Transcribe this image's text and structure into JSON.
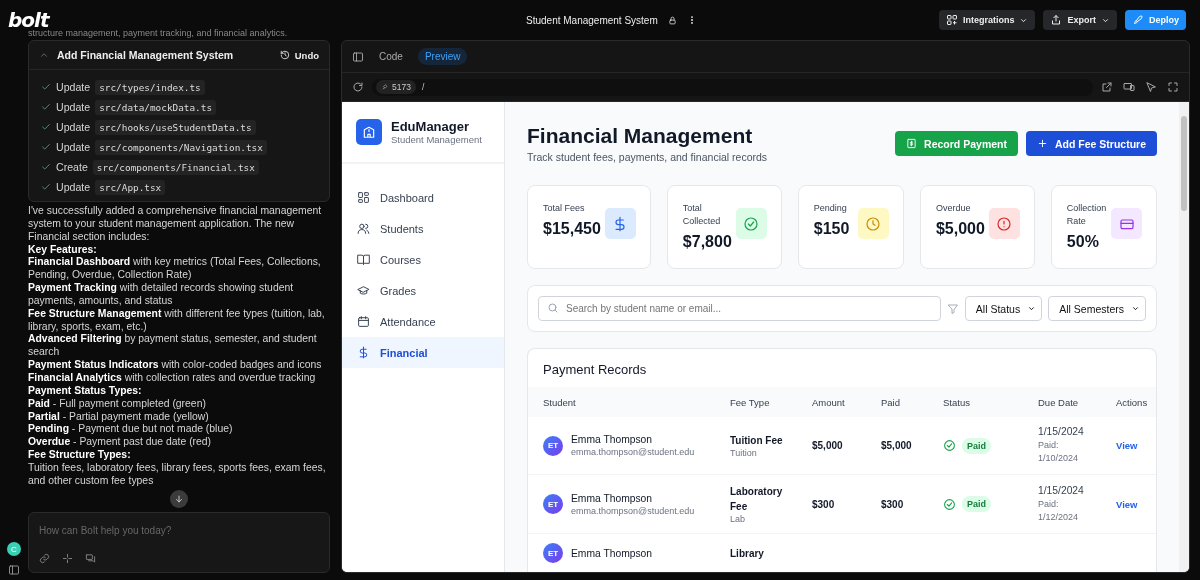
{
  "header": {
    "logo": "bolt",
    "project_title": "Student Management System",
    "buttons": [
      {
        "label": "Integrations",
        "kind": "integrations"
      },
      {
        "label": "Export",
        "kind": "export"
      },
      {
        "label": "Deploy",
        "kind": "deploy"
      }
    ]
  },
  "chat": {
    "cut_line": "structure management, payment tracking, and financial analytics.",
    "action_card": {
      "title": "Add Financial Management System",
      "undo": "Undo",
      "expanded": true,
      "steps": [
        {
          "verb": "Update",
          "file": "src/types/index.ts",
          "done": true
        },
        {
          "verb": "Update",
          "file": "src/data/mockData.ts",
          "done": true
        },
        {
          "verb": "Update",
          "file": "src/hooks/useStudentData.ts",
          "done": true
        },
        {
          "verb": "Update",
          "file": "src/components/Navigation.tsx",
          "done": true
        },
        {
          "verb": "Create",
          "file": "src/components/Financial.tsx",
          "done": true
        },
        {
          "verb": "Update",
          "file": "src/App.tsx",
          "done": true
        }
      ]
    },
    "message": [
      {
        "kind": "text",
        "text": "I've successfully added a comprehensive financial management system to your student management application. The new Financial section includes:"
      },
      {
        "kind": "heading",
        "text": "Key Features:"
      },
      {
        "kind": "text",
        "text": "**Financial Dashboard** with key metrics (Total Fees, Collections, Pending, Overdue, Collection Rate)"
      },
      {
        "kind": "text",
        "text": "**Payment Tracking** with detailed records showing student payments, amounts, and status"
      },
      {
        "kind": "text",
        "text": "**Fee Structure Management** with different fee types (tuition, lab, library, sports, exam, etc.)"
      },
      {
        "kind": "text",
        "text": "**Advanced Filtering** by payment status, semester, and student search"
      },
      {
        "kind": "text",
        "text": "**Payment Status Indicators** with color-coded badges and icons"
      },
      {
        "kind": "text",
        "text": "**Financial Analytics** with collection rates and overdue tracking"
      },
      {
        "kind": "heading",
        "text": "Payment Status Types:"
      },
      {
        "kind": "text",
        "text": "**Paid** - Full payment completed (green)"
      },
      {
        "kind": "text",
        "text": "**Partial** - Partial payment made (yellow)"
      },
      {
        "kind": "text",
        "text": "**Pending** - Payment due but not made (blue)"
      },
      {
        "kind": "text",
        "text": "**Overdue** - Payment past due date (red)"
      },
      {
        "kind": "heading",
        "text": "Fee Structure Types:"
      },
      {
        "kind": "text",
        "text": "Tuition fees, laboratory fees, library fees, sports fees, exam fees, and other custom fee types"
      }
    ],
    "input": {
      "placeholder": "How can Bolt help you today?"
    },
    "user_initial": "C"
  },
  "preview": {
    "tabs": [
      {
        "label": "Code",
        "selected": false
      },
      {
        "label": "Preview",
        "selected": true
      }
    ],
    "port": "5173",
    "path": "/"
  },
  "app": {
    "brand": {
      "name": "EduManager",
      "subtitle": "Student Management"
    },
    "nav": [
      {
        "label": "Dashboard",
        "kind": "grid",
        "selected": false
      },
      {
        "label": "Students",
        "kind": "users",
        "selected": false
      },
      {
        "label": "Courses",
        "kind": "book",
        "selected": false
      },
      {
        "label": "Grades",
        "kind": "cap",
        "selected": false
      },
      {
        "label": "Attendance",
        "kind": "calendar",
        "selected": false
      },
      {
        "label": "Financial",
        "kind": "dollar",
        "selected": true
      }
    ],
    "title": "Financial Management",
    "subtitle": "Track student fees, payments, and financial records",
    "actions": [
      {
        "label": "Record Payment",
        "kind": "record"
      },
      {
        "label": "Add Fee Structure",
        "kind": "add"
      }
    ],
    "stats": [
      {
        "label": "Total Fees",
        "value": "$15,450",
        "kind": "dollar"
      },
      {
        "label": "Total Collected",
        "value": "$7,800",
        "kind": "check"
      },
      {
        "label": "Pending",
        "value": "$150",
        "kind": "clock"
      },
      {
        "label": "Overdue",
        "value": "$5,000",
        "kind": "alert"
      },
      {
        "label": "Collection Rate",
        "value": "50%",
        "kind": "card"
      }
    ],
    "search": {
      "placeholder": "Search by student name or email..."
    },
    "filters": [
      "All Status",
      "All Semesters"
    ],
    "table": {
      "title": "Payment Records",
      "columns": [
        "Student",
        "Fee Type",
        "Amount",
        "Paid",
        "Status",
        "Due Date",
        "Actions"
      ],
      "rows": [
        {
          "initials": "ET",
          "name": "Emma Thompson",
          "email": "emma.thompson@student.edu",
          "fee_type": "Tuition Fee",
          "fee_category": "Tuition",
          "amount": "$5,000",
          "paid": "$5,000",
          "status": {
            "kind": "paid",
            "label": "Paid"
          },
          "due": "1/15/2024",
          "paid_on": "Paid: 1/10/2024",
          "action": "View"
        },
        {
          "initials": "ET",
          "name": "Emma Thompson",
          "email": "emma.thompson@student.edu",
          "fee_type": "Laboratory Fee",
          "fee_category": "Lab",
          "amount": "$300",
          "paid": "$300",
          "status": {
            "kind": "paid",
            "label": "Paid"
          },
          "due": "1/15/2024",
          "paid_on": "Paid: 1/12/2024",
          "action": "View"
        },
        {
          "initials": "ET",
          "name": "Emma Thompson",
          "fee_type": "Library"
        }
      ]
    }
  }
}
